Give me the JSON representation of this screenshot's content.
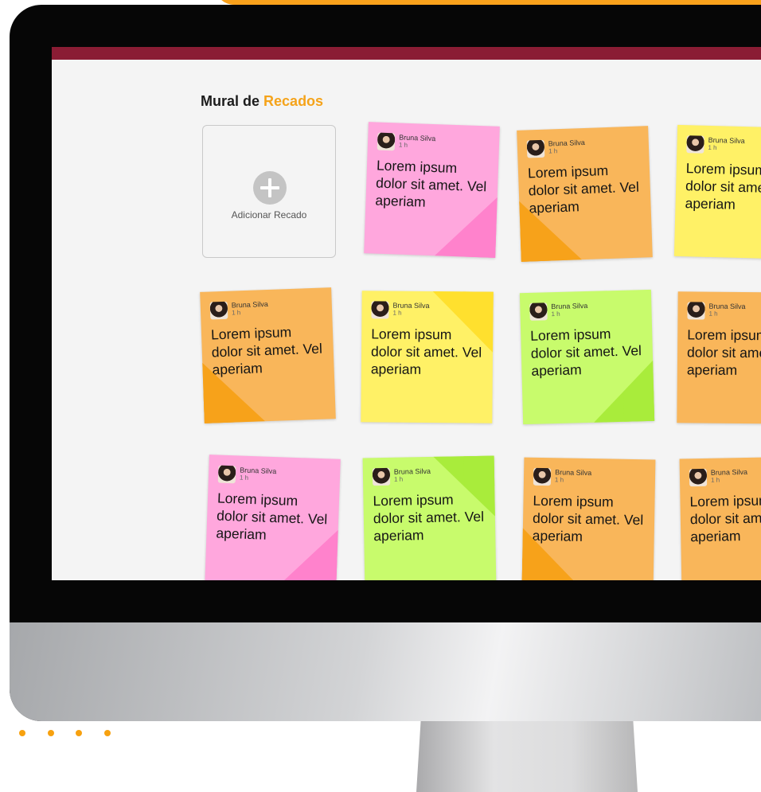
{
  "app": {
    "title_prefix": "Mural de",
    "title_accent": "Recados",
    "add_label": "Adicionar Recado"
  },
  "colors": {
    "accent": "#f5a31a",
    "topbar": "#8a1c34",
    "pink": "#ffa7dd",
    "orange": "#f9b65a",
    "yellow": "#fff166",
    "green": "#c8fb6c"
  },
  "notes": [
    {
      "author": "Bruna Silva",
      "time": "1 h",
      "text": "Lorem ipsum dolor sit amet. Vel aperiam",
      "color": "pink"
    },
    {
      "author": "Bruna Silva",
      "time": "1 h",
      "text": "Lorem ipsum dolor sit amet. Vel aperiam",
      "color": "orange"
    },
    {
      "author": "Bruna Silva",
      "time": "1 h",
      "text": "Lorem ipsum dolor sit amet. Vel aperiam",
      "color": "yellow"
    },
    {
      "author": "Bruna Silva",
      "time": "1 h",
      "text": "Lorem ipsum dolor sit amet. Vel aperiam",
      "color": "orange"
    },
    {
      "author": "Bruna Silva",
      "time": "1 h",
      "text": "Lorem ipsum dolor sit amet. Vel aperiam",
      "color": "yellow"
    },
    {
      "author": "Bruna Silva",
      "time": "1 h",
      "text": "Lorem ipsum dolor sit amet. Vel aperiam",
      "color": "green"
    },
    {
      "author": "Bruna Silva",
      "time": "1 h",
      "text": "Lorem ipsum dolor sit amet. Vel aperiam",
      "color": "orange"
    },
    {
      "author": "Bruna Silva",
      "time": "1 h",
      "text": "Lorem ipsum dolor sit amet. Vel aperiam",
      "color": "pink"
    },
    {
      "author": "Bruna Silva",
      "time": "1 h",
      "text": "Lorem ipsum dolor sit amet. Vel aperiam",
      "color": "green"
    },
    {
      "author": "Bruna Silva",
      "time": "1 h",
      "text": "Lorem ipsum dolor sit amet. Vel aperiam",
      "color": "orange"
    },
    {
      "author": "Bruna Silva",
      "time": "1 h",
      "text": "Lorem ipsum dolor sit amet. Vel aperiam",
      "color": "orange"
    }
  ],
  "icons": {
    "add": "plus-circle-icon",
    "avatar": "user-avatar"
  }
}
